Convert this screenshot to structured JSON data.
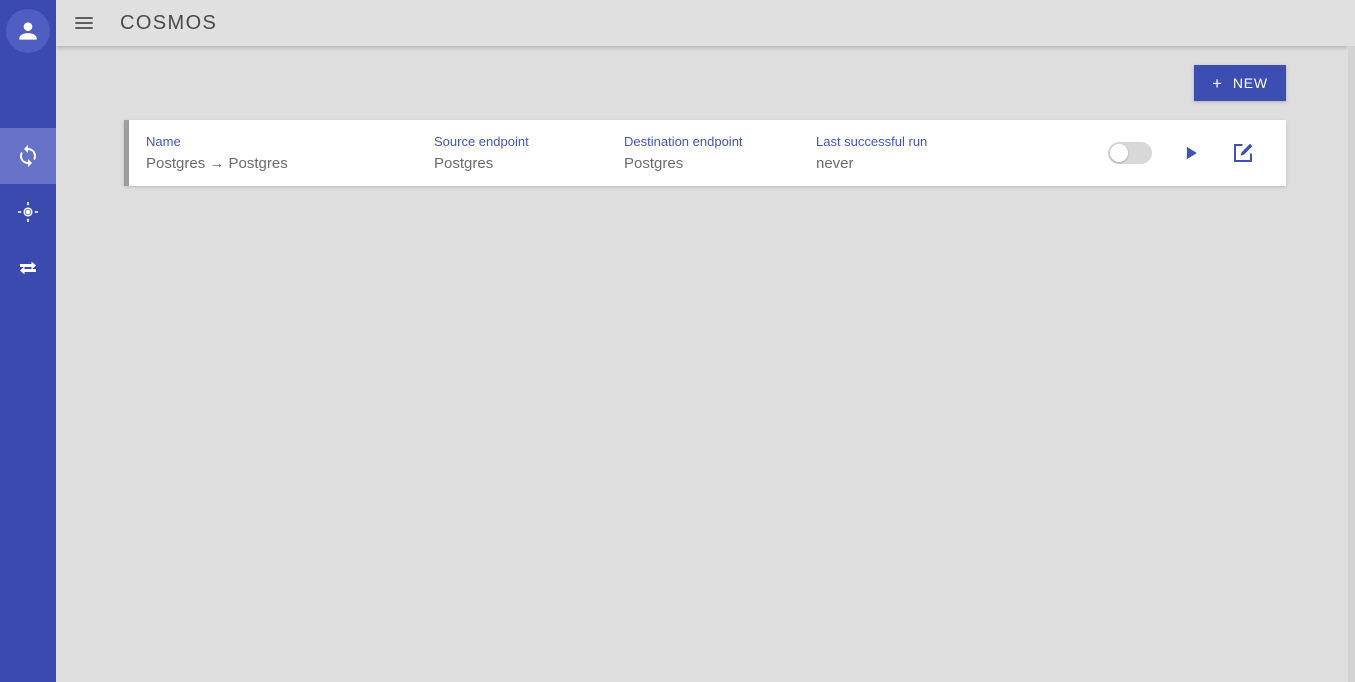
{
  "app": {
    "title": "COSMOS",
    "accent_color": "#3f51b5",
    "rail_color": "#3b4aaf",
    "background_color": "#dedede"
  },
  "rail": {
    "avatar_icon": "person-icon",
    "items": [
      {
        "icon": "sync-icon",
        "name": "sync",
        "active": true
      },
      {
        "icon": "gps-fixed-icon",
        "name": "gps-fixed",
        "active": false
      },
      {
        "icon": "compare-arrows-icon",
        "name": "compare-arrows",
        "active": false
      }
    ]
  },
  "toolbar": {
    "menu_icon": "hamburger-menu-icon",
    "title": "COSMOS"
  },
  "actions_bar": {
    "new_button": {
      "plus": "+",
      "label": "NEW",
      "icon": "plus-icon"
    }
  },
  "list": {
    "columns": [
      {
        "key": "name",
        "label": "Name"
      },
      {
        "key": "source",
        "label": "Source endpoint"
      },
      {
        "key": "destination",
        "label": "Destination endpoint"
      },
      {
        "key": "last_run",
        "label": "Last successful run"
      }
    ],
    "rows": [
      {
        "name": "Postgres → Postgres",
        "source": "Postgres",
        "destination": "Postgres",
        "last_run": "never",
        "enabled": false,
        "accent_color": "#9e9e9e",
        "toggle_icon": "toggle-off-icon",
        "run_icon": "play-icon",
        "edit_icon": "edit-icon"
      }
    ]
  }
}
